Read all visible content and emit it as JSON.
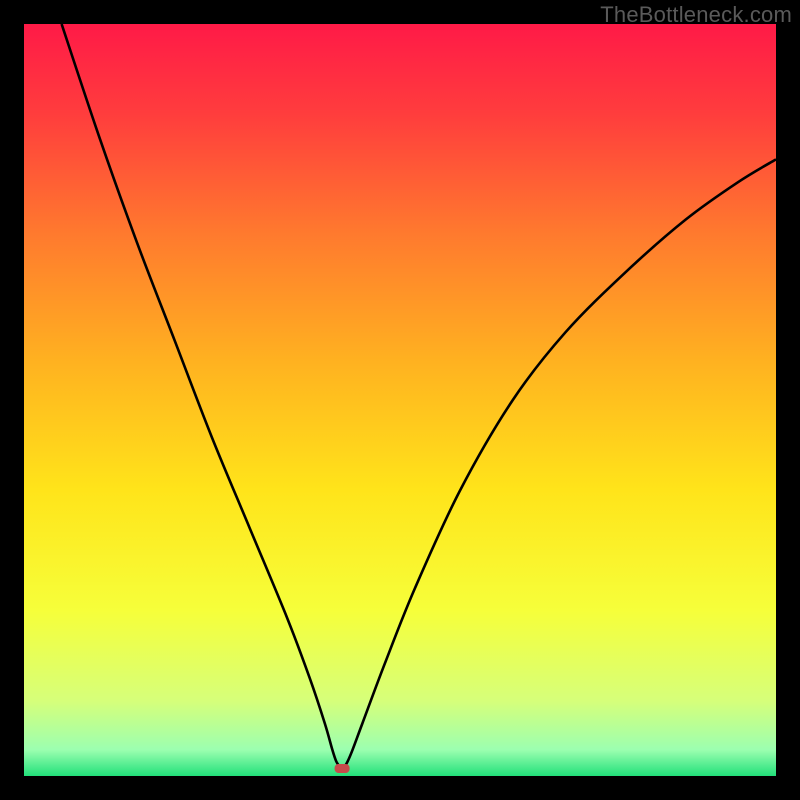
{
  "watermark": "TheBottleneck.com",
  "chart_data": {
    "type": "line",
    "title": "",
    "xlabel": "",
    "ylabel": "",
    "xlim": [
      0,
      100
    ],
    "ylim": [
      0,
      100
    ],
    "grid": false,
    "legend": false,
    "background_gradient": {
      "stops": [
        {
          "offset": 0.0,
          "color": "#ff1a47"
        },
        {
          "offset": 0.12,
          "color": "#ff3d3d"
        },
        {
          "offset": 0.28,
          "color": "#ff7a2e"
        },
        {
          "offset": 0.45,
          "color": "#ffb220"
        },
        {
          "offset": 0.62,
          "color": "#ffe41a"
        },
        {
          "offset": 0.78,
          "color": "#f6ff3a"
        },
        {
          "offset": 0.9,
          "color": "#d6ff7a"
        },
        {
          "offset": 0.965,
          "color": "#9cffb0"
        },
        {
          "offset": 1.0,
          "color": "#22e07a"
        }
      ]
    },
    "series": [
      {
        "name": "bottleneck-curve",
        "color": "#000000",
        "x": [
          5,
          10,
          15,
          20,
          25,
          30,
          35,
          38,
          40,
          41,
          41.5,
          42,
          42.3,
          42.8,
          43.5,
          45,
          48,
          52,
          58,
          65,
          72,
          80,
          88,
          95,
          100
        ],
        "y": [
          100,
          85,
          71,
          58,
          45,
          33,
          21,
          13,
          7,
          3.5,
          2.0,
          1.2,
          1.0,
          1.5,
          3,
          7,
          15,
          25,
          38,
          50,
          59,
          67,
          74,
          79,
          82
        ]
      }
    ],
    "markers": [
      {
        "name": "minimum-point",
        "shape": "rounded-rect",
        "x": 42.3,
        "y": 1.0,
        "color": "#c74b4b",
        "width_frac": 0.02,
        "height_frac": 0.012
      }
    ]
  }
}
